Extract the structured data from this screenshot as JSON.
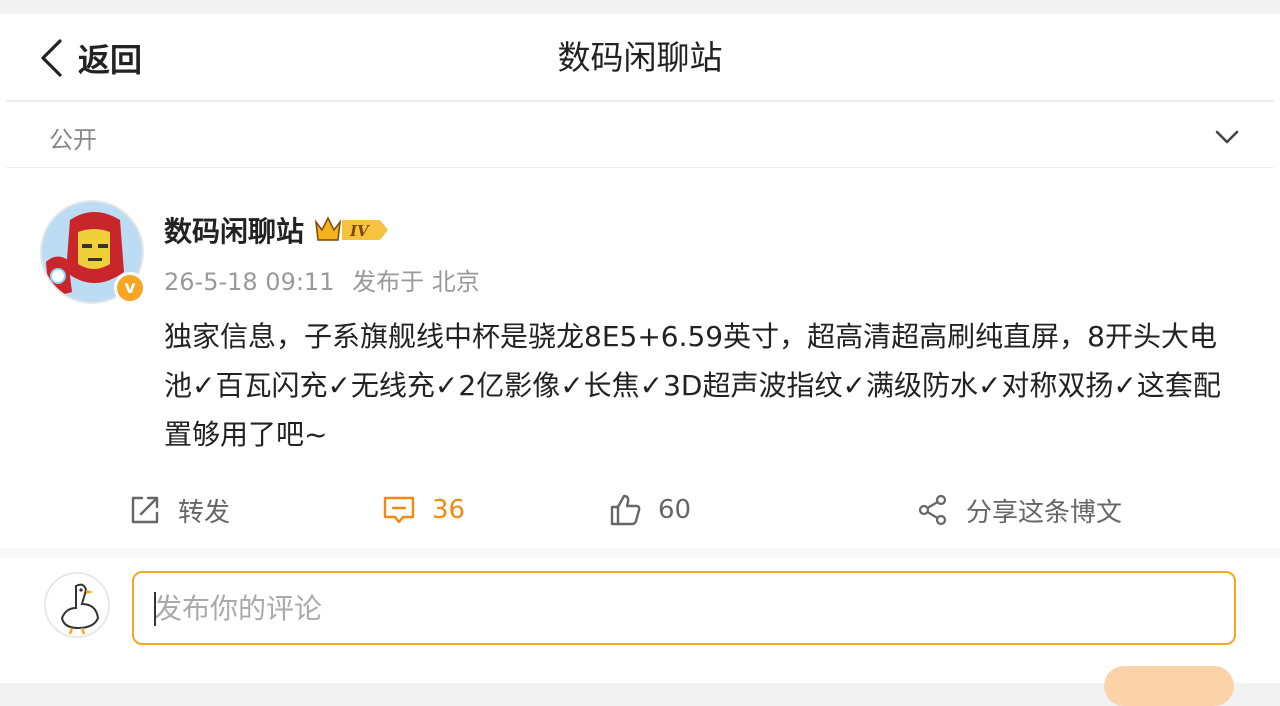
{
  "header": {
    "back_label": "返回",
    "title": "数码闲聊站"
  },
  "visibility": {
    "label": "公开"
  },
  "post": {
    "author": "数码闲聊站",
    "level_badge": "IV",
    "verified_badge": "v",
    "time": "26-5-18 09:11",
    "location": "发布于 北京",
    "content": "独家信息，子系旗舰线中杯是骁龙8E5+6.59英寸，超高清超高刷纯直屏，8开头大电池✓百瓦闪充✓无线充✓2亿影像✓长焦✓3D超声波指纹✓满级防水✓对称双扬✓这套配置够用了吧~"
  },
  "actions": {
    "repost_label": "转发",
    "comment_count": "36",
    "like_count": "60",
    "share_label": "分享这条博文"
  },
  "comment": {
    "placeholder": "发布你的评论"
  },
  "colors": {
    "accent": "#f08a12",
    "input_border": "#f5a623",
    "badge": "#f6a623"
  },
  "icons": [
    "chevron-left-icon",
    "chevron-down-icon",
    "repost-icon",
    "comment-icon",
    "like-icon",
    "share-icon",
    "crown-badge-icon"
  ]
}
